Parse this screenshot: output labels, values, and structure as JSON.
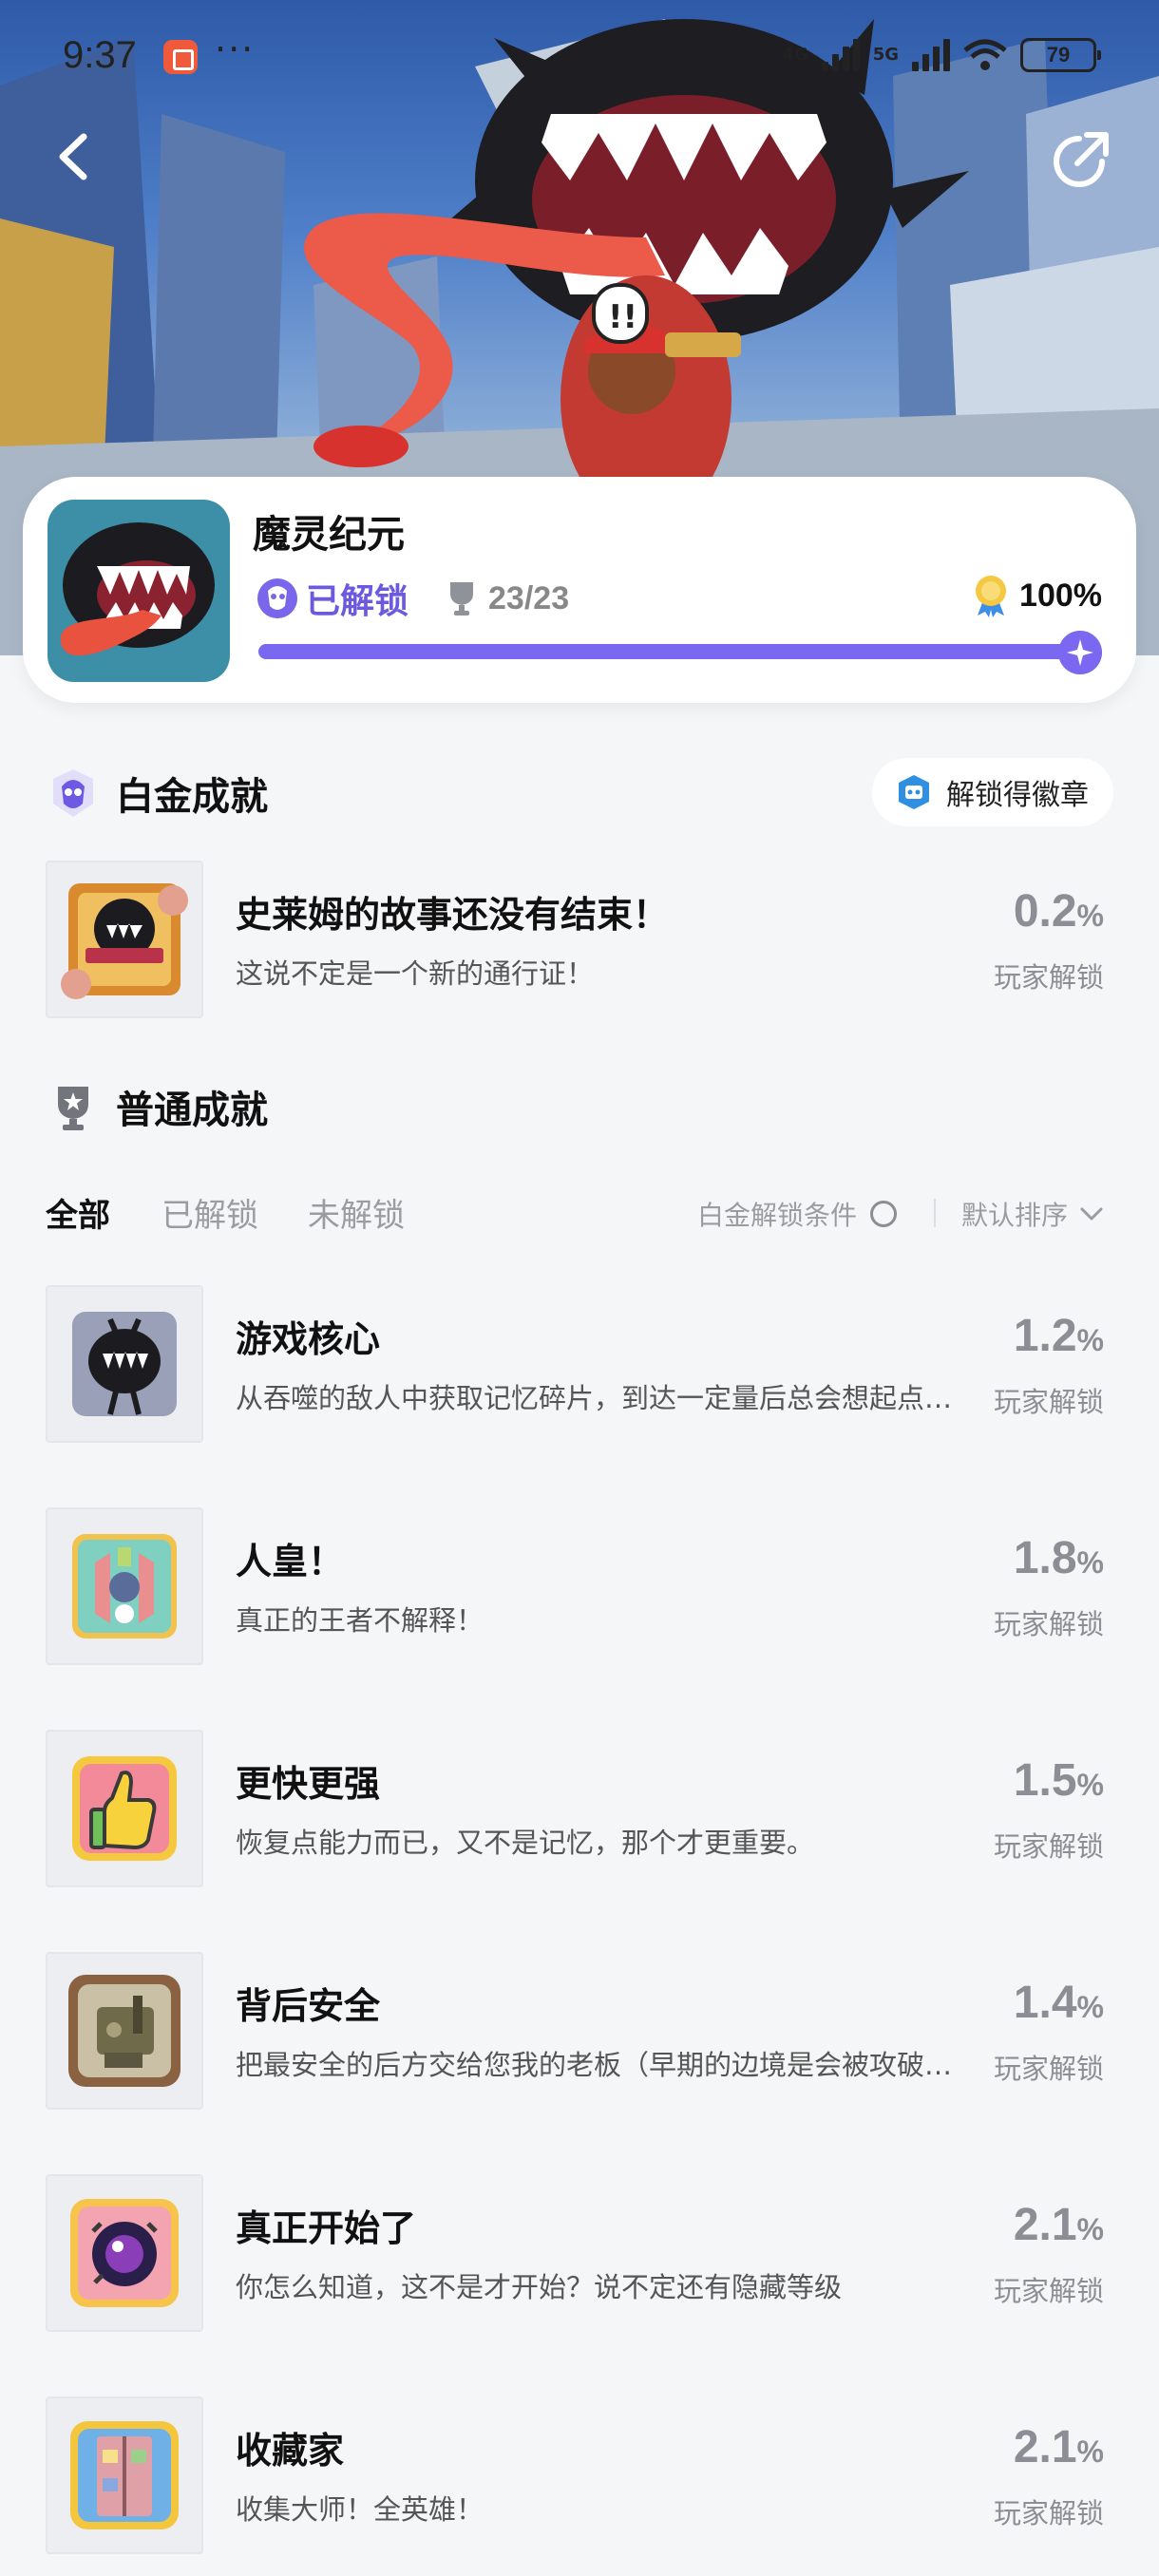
{
  "status_bar": {
    "time": "9:37",
    "dots": "···",
    "network_1": "4G",
    "network_2": "5G",
    "battery": "79"
  },
  "game": {
    "title": "魔灵纪元",
    "unlock_status": "已解锁",
    "trophy_count": "23/23",
    "completion_percent": "100%",
    "progress_fraction": 1.0
  },
  "platinum": {
    "section_title": "白金成就",
    "badge_button": "解锁得徽章",
    "achievement": {
      "name": "史莱姆的故事还没有结束！",
      "desc": "这说不定是一个新的通行证！",
      "rate": "0.2",
      "unit": "%",
      "caption": "玩家解锁"
    }
  },
  "normal": {
    "section_title": "普通成就",
    "tabs": [
      "全部",
      "已解锁",
      "未解锁"
    ],
    "active_tab": "全部",
    "condition_label": "白金解锁条件",
    "sort_label": "默认排序",
    "achievements": [
      {
        "name": "游戏核心",
        "desc": "从吞噬的敌人中获取记忆碎片，到达一定量后总会想起点什么",
        "rate": "1.2",
        "unit": "%",
        "caption": "玩家解锁"
      },
      {
        "name": "人皇！",
        "desc": "真正的王者不解释！",
        "rate": "1.8",
        "unit": "%",
        "caption": "玩家解锁"
      },
      {
        "name": "更快更强",
        "desc": "恢复点能力而已，又不是记忆，那个才更重要。",
        "rate": "1.5",
        "unit": "%",
        "caption": "玩家解锁"
      },
      {
        "name": "背后安全",
        "desc": "把最安全的后方交给您我的老板（早期的边境是会被攻破的）",
        "rate": "1.4",
        "unit": "%",
        "caption": "玩家解锁"
      },
      {
        "name": "真正开始了",
        "desc": "你怎么知道，这不是才开始？说不定还有隐藏等级",
        "rate": "2.1",
        "unit": "%",
        "caption": "玩家解锁"
      },
      {
        "name": "收藏家",
        "desc": "收集大师！全英雄！",
        "rate": "2.1",
        "unit": "%",
        "caption": "玩家解锁"
      }
    ]
  },
  "colors": {
    "accent": "#7b68f0",
    "accent_text": "#6b5ae0",
    "muted": "#8b8e94",
    "page_bg": "#f5f6f8"
  }
}
